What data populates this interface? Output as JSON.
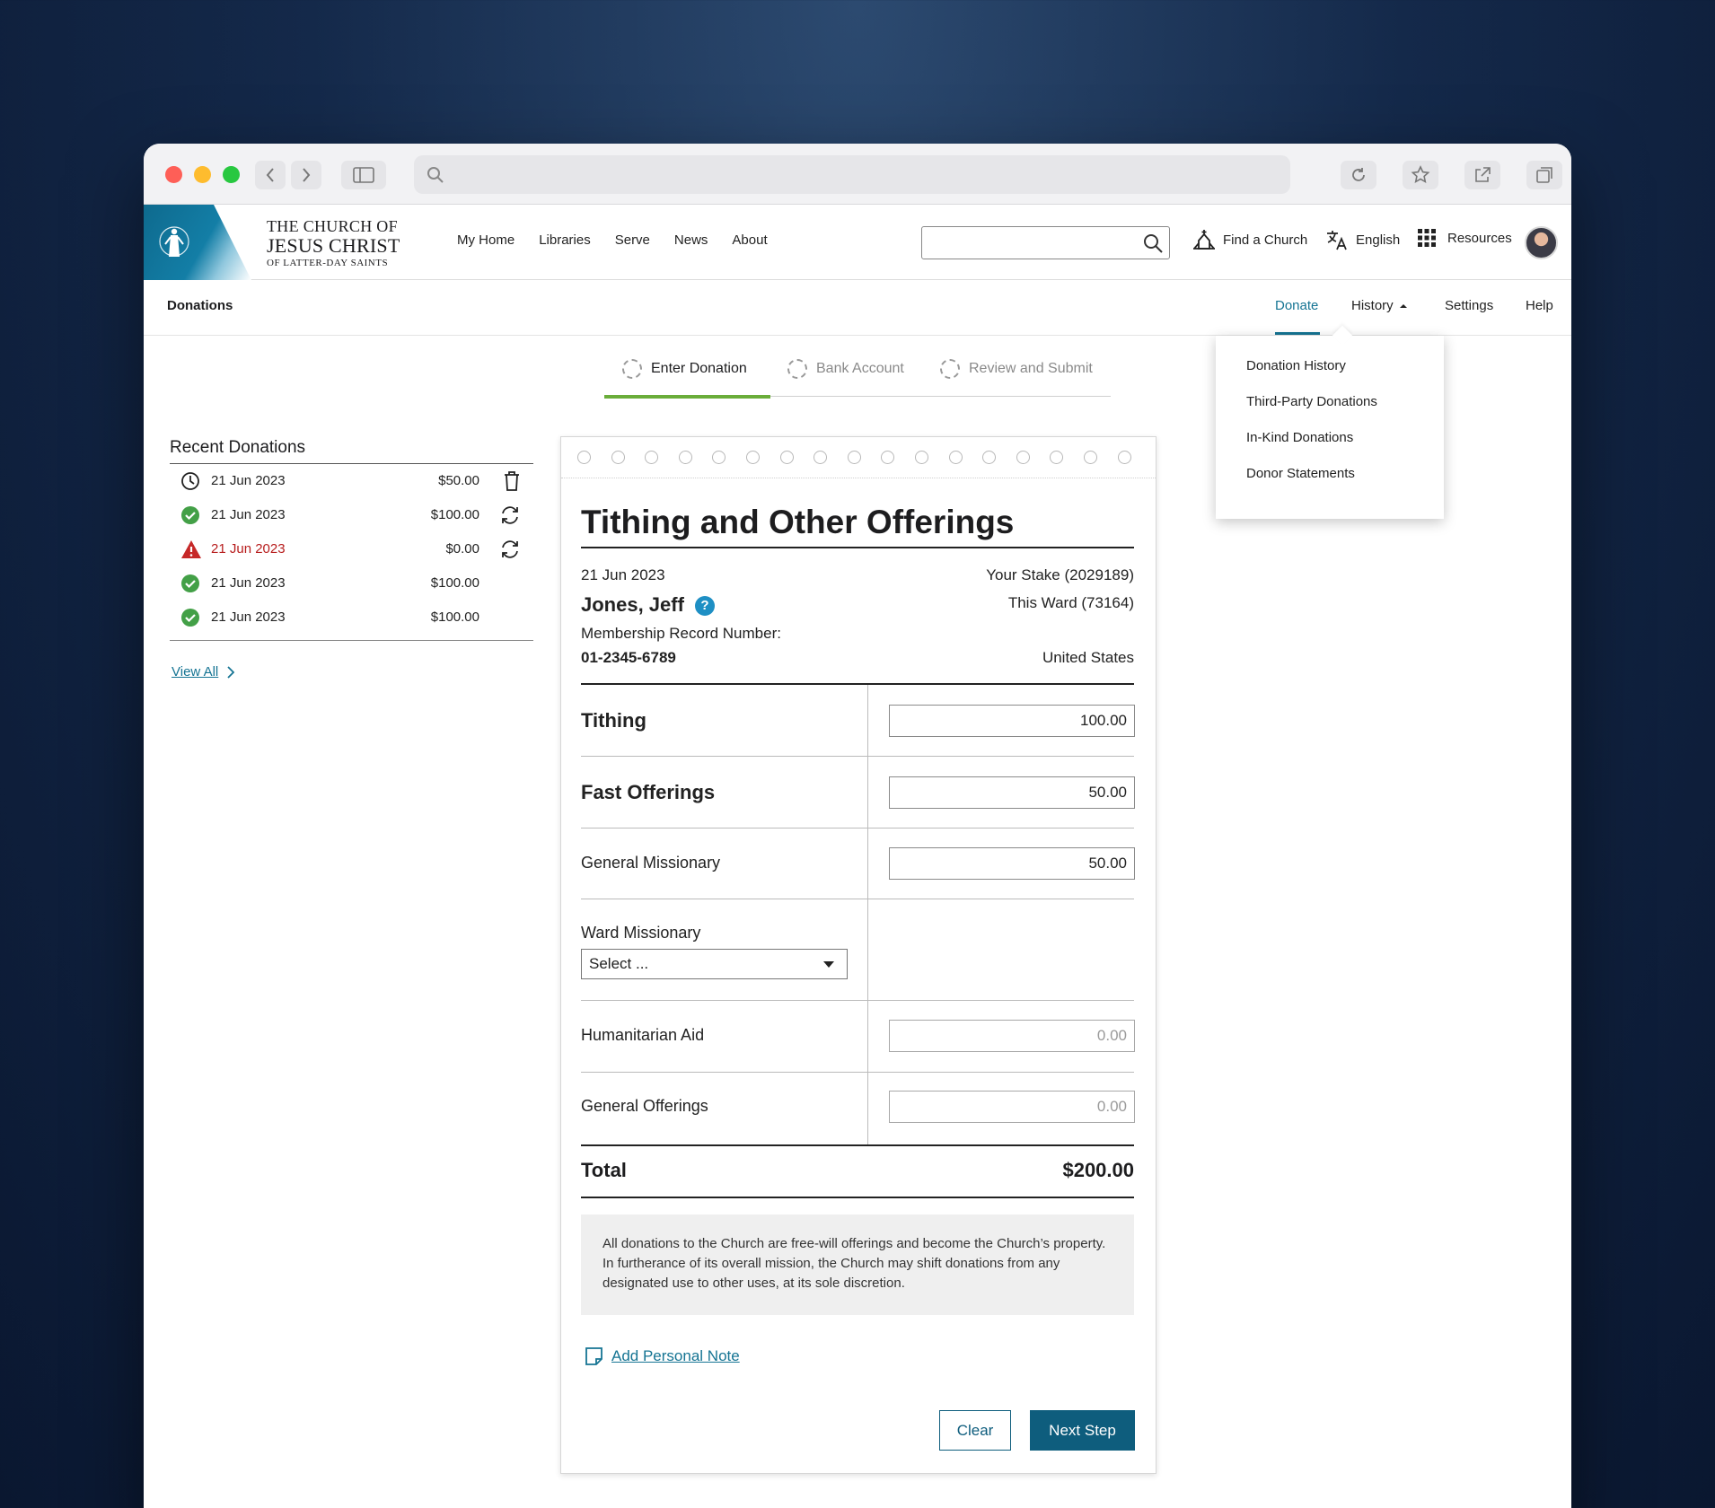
{
  "header": {
    "logo_line1": "THE CHURCH OF",
    "logo_line2": "JESUS CHRIST",
    "logo_line3": "OF LATTER-DAY SAINTS",
    "nav": [
      "My Home",
      "Libraries",
      "Serve",
      "News",
      "About"
    ],
    "find_church": "Find a Church",
    "language": "English",
    "resources": "Resources"
  },
  "subnav": {
    "title": "Donations",
    "links": [
      "Donate",
      "History",
      "Settings",
      "Help"
    ],
    "active": "Donate"
  },
  "history_menu": [
    "Donation History",
    "Third-Party Donations",
    "In-Kind Donations",
    "Donor Statements"
  ],
  "steps": [
    "Enter Donation",
    "Bank Account",
    "Review and Submit"
  ],
  "recent": {
    "title": "Recent Donations",
    "rows": [
      {
        "date": "21 Jun 2023",
        "amount": "$50.00",
        "status": "pending",
        "action": "delete"
      },
      {
        "date": "21 Jun 2023",
        "amount": "$100.00",
        "status": "success",
        "action": "repeat"
      },
      {
        "date": "21 Jun 2023",
        "amount": "$0.00",
        "status": "error",
        "action": "repeat"
      },
      {
        "date": "21 Jun 2023",
        "amount": "$100.00",
        "status": "success",
        "action": "none"
      },
      {
        "date": "21 Jun 2023",
        "amount": "$100.00",
        "status": "success",
        "action": "none"
      }
    ],
    "view_all": "View All"
  },
  "form": {
    "title": "Tithing and Other Offerings",
    "date": "21 Jun 2023",
    "name": "Jones, Jeff",
    "stake": "Your Stake (2029189)",
    "ward": "This Ward (73164)",
    "mrn_label": "Membership Record Number:",
    "mrn": "01-2345-6789",
    "country": "United States",
    "rows": {
      "tithing": {
        "label": "Tithing",
        "value": "100.00"
      },
      "fast": {
        "label": "Fast Offerings",
        "value": "50.00"
      },
      "general_missionary": {
        "label": "General Missionary",
        "value": "50.00"
      },
      "ward_missionary": {
        "label": "Ward Missionary",
        "select": "Select ..."
      },
      "humanitarian": {
        "label": "Humanitarian Aid",
        "placeholder": "0.00"
      },
      "general_offerings": {
        "label": "General Offerings",
        "placeholder": "0.00"
      }
    },
    "total_label": "Total",
    "total_value": "$200.00",
    "notice": "All donations to the Church are free-will offerings and become the Church’s property. In furtherance of its overall mission, the Church may shift donations from any designated use to other uses, at its sole discretion.",
    "add_note": "Add Personal Note",
    "clear": "Clear",
    "next": "Next Step"
  },
  "colors": {
    "accent": "#0e5d7d",
    "link": "#157493",
    "success": "#43a047",
    "error": "#c62828",
    "step_active": "#6aad3a"
  }
}
